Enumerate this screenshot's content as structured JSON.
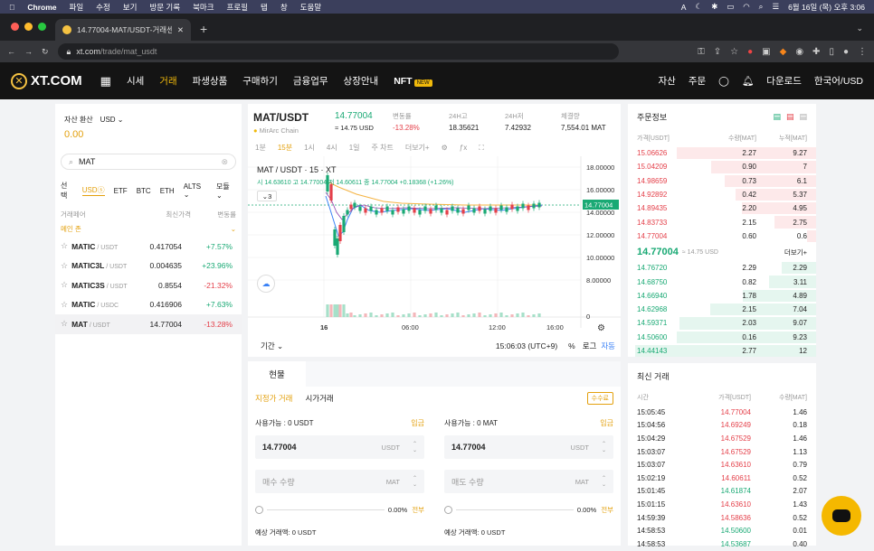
{
  "mac": {
    "app": "Chrome",
    "menus": [
      "파일",
      "수정",
      "보기",
      "방문 기록",
      "북마크",
      "프로필",
      "탭",
      "창",
      "도움말"
    ],
    "clock": "6월 16일 (목) 오후 3:06"
  },
  "browser": {
    "tab_title": "14.77004-MAT/USDT-거래센터-",
    "url_host": "xt.com",
    "url_path": "/trade/mat_usdt"
  },
  "nav": {
    "logo": "XT.COM",
    "items": [
      "시세",
      "거래",
      "파생상품",
      "구매하기",
      "금융업무",
      "상장안내"
    ],
    "nft": "NFT",
    "new_badge": "NEW",
    "right": [
      "자산",
      "주문"
    ],
    "download": "다운로드",
    "lang": "한국어/USD"
  },
  "wallet": {
    "label": "자산 환산",
    "currency": "USD",
    "value": "0.00"
  },
  "search": {
    "value": "MAT"
  },
  "market_tabs": [
    "선택",
    "USDⓢ",
    "ETF",
    "BTC",
    "ETH",
    "ALTS",
    "모듈"
  ],
  "list_head": {
    "pair": "거래페어",
    "price": "최신가격",
    "change": "변동률"
  },
  "main_zone": "메인 존",
  "pairs": [
    {
      "base": "MATIC",
      "quote": "/ USDT",
      "price": "0.417054",
      "change": "+7.57%",
      "up": true
    },
    {
      "base": "MATIC3L",
      "quote": "/ USDT",
      "price": "0.004635",
      "change": "+23.96%",
      "up": true
    },
    {
      "base": "MATIC3S",
      "quote": "/ USDT",
      "price": "0.8554",
      "change": "-21.32%",
      "up": false
    },
    {
      "base": "MATIC",
      "quote": "/ USDC",
      "price": "0.416906",
      "change": "+7.63%",
      "up": true
    },
    {
      "base": "MAT",
      "quote": "/ USDT",
      "price": "14.77004",
      "change": "-13.28%",
      "up": false
    }
  ],
  "ticker": {
    "pair": "MAT/USDT",
    "chain": "MirArc Chain",
    "last": "14.77004",
    "usd": "≈ 14.75 USD",
    "chg_label": "변동률",
    "chg": "-13.28%",
    "high_label": "24H고",
    "high": "18.35621",
    "low_label": "24H저",
    "low": "7.42932",
    "vol_label": "체결량",
    "vol": "7,554.01 MAT"
  },
  "chart": {
    "intervals": [
      "1분",
      "15분",
      "1시",
      "4시",
      "1일",
      "주 차트",
      "더보기+"
    ],
    "title": "MAT / USDT · 15 · XT",
    "ohlc": "시 14.63610 고 14.77004 저 14.60611 종 14.77004 +0.18368 (+1.26%)",
    "ma_count": "3",
    "price_axis": [
      "18.00000",
      "16.00000",
      "14.00000",
      "12.00000",
      "10.00000",
      "8.00000",
      "0"
    ],
    "last_tag": "14.77004",
    "time_axis": [
      "16",
      "06:00",
      "12:00",
      "16:00"
    ],
    "range": "기간",
    "clock": "15:06:03 (UTC+9)",
    "pct": "%",
    "log": "로그",
    "auto": "자동"
  },
  "order": {
    "tab": "현물",
    "types": [
      "지정가 거래",
      "시가거래"
    ],
    "fee": "수수료",
    "buy_avail": "사용가능 : 0 USDT",
    "sell_avail": "사용가능 : 0 MAT",
    "deposit": "입금",
    "price": "14.77004",
    "price_unit": "USDT",
    "buy_qty": "매수 수량",
    "sell_qty": "매도 수량",
    "qty_unit": "MAT",
    "pct": "0.00%",
    "all": "전부",
    "buy_est": "예상 거래액: 0 USDT",
    "sell_est": "예상 거래액: 0 USDT"
  },
  "book": {
    "title": "주문정보",
    "head": [
      "가격[USDT]",
      "수량[MAT]",
      "누적[MAT]"
    ],
    "asks": [
      [
        "15.06626",
        "2.27",
        "9.27"
      ],
      [
        "15.04209",
        "0.90",
        "7"
      ],
      [
        "14.98659",
        "0.73",
        "6.1"
      ],
      [
        "14.92892",
        "0.42",
        "5.37"
      ],
      [
        "14.89435",
        "2.20",
        "4.95"
      ],
      [
        "14.83733",
        "2.15",
        "2.75"
      ],
      [
        "14.77004",
        "0.60",
        "0.6"
      ]
    ],
    "mid_price": "14.77004",
    "mid_usd": "≈ 14.75 USD",
    "more": "더보기+",
    "bids": [
      [
        "14.76720",
        "2.29",
        "2.29"
      ],
      [
        "14.68750",
        "0.82",
        "3.11"
      ],
      [
        "14.66940",
        "1.78",
        "4.89"
      ],
      [
        "14.62968",
        "2.15",
        "7.04"
      ],
      [
        "14.59371",
        "2.03",
        "9.07"
      ],
      [
        "14.50600",
        "0.16",
        "9.23"
      ],
      [
        "14.44143",
        "2.77",
        "12"
      ]
    ]
  },
  "trades": {
    "title": "최신 거래",
    "head": [
      "시간",
      "가격[USDT]",
      "수량[MAT]"
    ],
    "rows": [
      [
        "15:05:45",
        "14.77004",
        "1.46",
        false
      ],
      [
        "15:04:56",
        "14.69249",
        "0.18",
        false
      ],
      [
        "15:04:29",
        "14.67529",
        "1.46",
        false
      ],
      [
        "15:03:07",
        "14.67529",
        "1.13",
        false
      ],
      [
        "15:03:07",
        "14.63610",
        "0.79",
        false
      ],
      [
        "15:02:19",
        "14.60611",
        "0.52",
        false
      ],
      [
        "15:01:45",
        "14.61874",
        "2.07",
        true
      ],
      [
        "15:01:15",
        "14.63610",
        "1.43",
        false
      ],
      [
        "14:59:39",
        "14.58636",
        "0.52",
        false
      ],
      [
        "14:58:53",
        "14.50600",
        "0.01",
        true
      ],
      [
        "14:58:53",
        "14.53687",
        "0.40",
        true
      ]
    ]
  }
}
